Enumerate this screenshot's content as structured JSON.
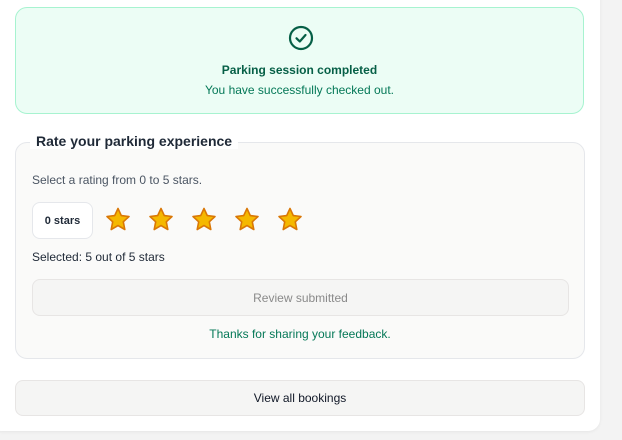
{
  "banner": {
    "icon": "check-circle-icon",
    "title": "Parking session completed",
    "subtitle": "You have successfully checked out.",
    "accent_color": "#059669"
  },
  "rating": {
    "legend": "Rate your parking experience",
    "hint": "Select a rating from 0 to 5 stars.",
    "zero_label": "0 stars",
    "selected_count": 5,
    "max": 5,
    "selected_text": "Selected: 5 out of 5 stars",
    "star_color": "#f5b800",
    "star_outline": "#d97706",
    "review_button_label": "Review submitted",
    "thanks_text": "Thanks for sharing your feedback."
  },
  "footer": {
    "bookings_button_label": "View all bookings"
  }
}
